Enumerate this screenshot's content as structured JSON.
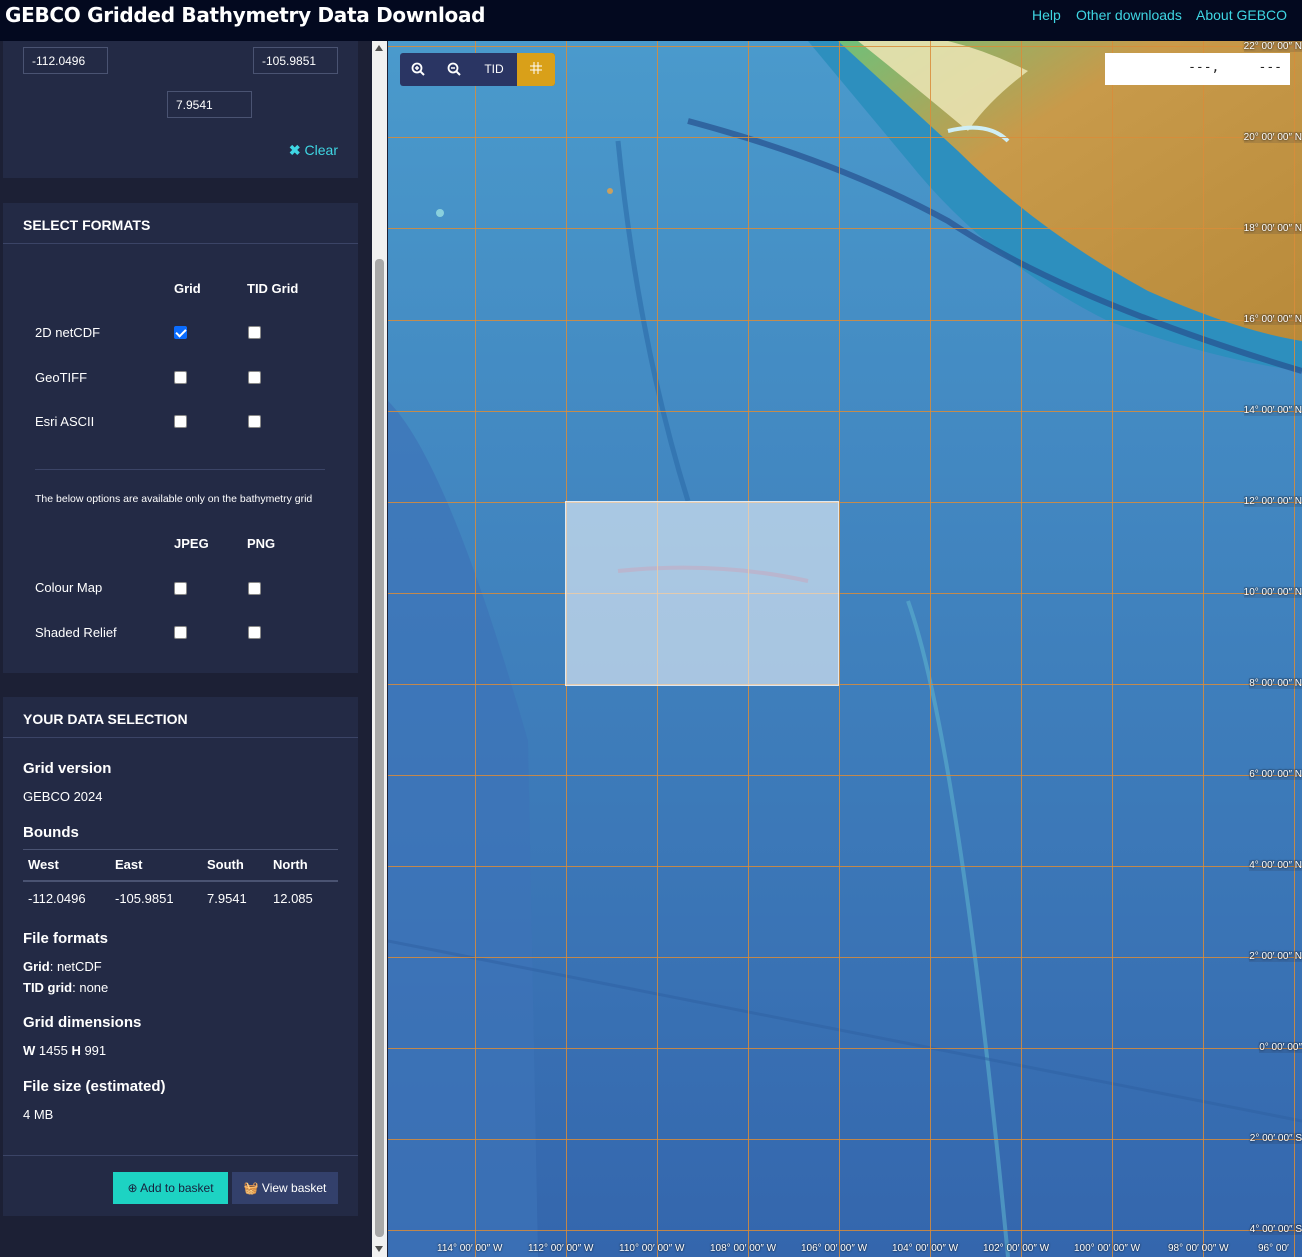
{
  "header": {
    "title": "GEBCO Gridded Bathymetry Data Download",
    "links": [
      "Help",
      "Other downloads",
      "About GEBCO"
    ]
  },
  "bounds_inputs": {
    "west": "-112.0496",
    "east": "-105.9851",
    "south": "7.9541",
    "clear_label": "Clear"
  },
  "formats": {
    "title": "SELECT FORMATS",
    "grid_col": "Grid",
    "tid_col": "TID Grid",
    "rows": [
      {
        "label": "2D netCDF",
        "grid": true,
        "tid": false
      },
      {
        "label": "GeoTIFF",
        "grid": false,
        "tid": false
      },
      {
        "label": "Esri ASCII",
        "grid": false,
        "tid": false
      }
    ],
    "note": "The below options are available only on the bathymetry grid",
    "jpeg_col": "JPEG",
    "png_col": "PNG",
    "image_rows": [
      {
        "label": "Colour Map",
        "jpeg": false,
        "png": false
      },
      {
        "label": "Shaded Relief",
        "jpeg": false,
        "png": false
      }
    ]
  },
  "selection": {
    "title": "YOUR DATA SELECTION",
    "grid_version_title": "Grid version",
    "grid_version": "GEBCO 2024",
    "bounds_title": "Bounds",
    "bounds_headers": [
      "West",
      "East",
      "South",
      "North"
    ],
    "bounds_values": [
      "-112.0496",
      "-105.9851",
      "7.9541",
      "12.085"
    ],
    "file_formats_title": "File formats",
    "grid_label": "Grid",
    "grid_value": ": netCDF",
    "tid_label": "TID grid",
    "tid_value": ": none",
    "dimensions_title": "Grid dimensions",
    "w_label": "W",
    "w_value": " 1455 ",
    "h_label": "H",
    "h_value": " 991",
    "filesize_title": "File size (estimated)",
    "filesize": "4 MB",
    "add_basket": "Add to basket",
    "view_basket": "View basket"
  },
  "map": {
    "tools": {
      "zoom_in": "zoom-in-icon",
      "zoom_out": "zoom-out-icon",
      "tid": "TID",
      "grid": "grid-icon"
    },
    "coord_readout": "---,     ---",
    "lat_labels": [
      "22° 00′ 00″ N",
      "20° 00′ 00″ N",
      "18° 00′ 00″ N",
      "16° 00′ 00″ N",
      "14° 00′ 00″ N",
      "12° 00′ 00″ N",
      "10° 00′ 00″ N",
      "8° 00′ 00″ N",
      "6° 00′ 00″ N",
      "4° 00′ 00″ N",
      "2° 00′ 00″ N",
      "0° 00′ 00″",
      "2° 00′ 00″ S",
      "4° 00′ 00″ S"
    ],
    "lon_labels": [
      "114° 00′ 00″ W",
      "112° 00′ 00″ W",
      "110° 00′ 00″ W",
      "108° 00′ 00″ W",
      "106° 00′ 00″ W",
      "104° 00′ 00″ W",
      "102° 00′ 00″ W",
      "100° 00′ 00″ W",
      "98° 00′ 00″ W",
      "96° 00′"
    ]
  },
  "colors": {
    "accent": "#3fd6e3",
    "panel": "#232a45",
    "grid_line": "#d98c3a",
    "tool_active": "#d9a019"
  }
}
